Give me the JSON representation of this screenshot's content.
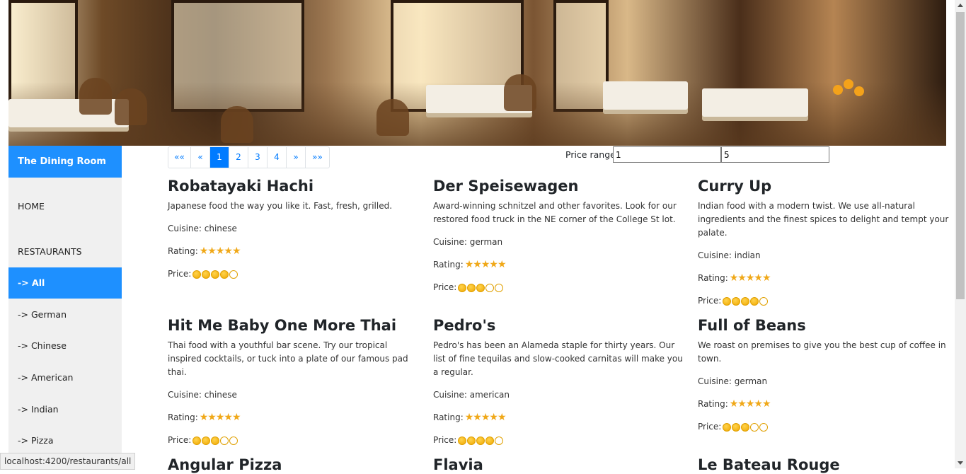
{
  "brand": "The Dining Room",
  "nav": {
    "home": "HOME",
    "restaurants": "RESTAURANTS",
    "items": [
      "-> All",
      "-> German",
      "-> Chinese",
      "-> American",
      "-> Indian",
      "-> Pizza"
    ]
  },
  "pagination": [
    "««",
    "«",
    "1",
    "2",
    "3",
    "4",
    "»",
    "»»"
  ],
  "price_range": {
    "label": "Price range",
    "min": "1",
    "max": "5"
  },
  "labels": {
    "cuisine": "Cuisine:",
    "rating": "Rating:",
    "price": "Price:"
  },
  "restaurants": [
    {
      "name": "Robatayaki Hachi",
      "description": "Japanese food the way you like it. Fast, fresh, grilled.",
      "cuisine": "chinese",
      "rating": 5,
      "price": 4
    },
    {
      "name": "Der Speisewagen",
      "description": "Award-winning schnitzel and other favorites. Look for our restored food truck in the NE corner of the College St lot.",
      "cuisine": "german",
      "rating": 5,
      "price": 3
    },
    {
      "name": "Curry Up",
      "description": "Indian food with a modern twist. We use all-natural ingredients and the finest spices to delight and tempt your palate.",
      "cuisine": "indian",
      "rating": 5,
      "price": 4
    },
    {
      "name": "Hit Me Baby One More Thai",
      "description": "Thai food with a youthful bar scene. Try our tropical inspired cocktails, or tuck into a plate of our famous pad thai.",
      "cuisine": "chinese",
      "rating": 5,
      "price": 3
    },
    {
      "name": "Pedro's",
      "description": "Pedro's has been an Alameda staple for thirty years. Our list of fine tequilas and slow-cooked carnitas will make you a regular.",
      "cuisine": "american",
      "rating": 5,
      "price": 4
    },
    {
      "name": "Full of Beans",
      "description": "We roast on premises to give you the best cup of coffee in town.",
      "cuisine": "german",
      "rating": 5,
      "price": 3
    },
    {
      "name": "Angular Pizza"
    },
    {
      "name": "Flavia"
    },
    {
      "name": "Le Bateau Rouge"
    }
  ],
  "status_url": "localhost:4200/restaurants/all",
  "colors": {
    "accent": "#1e90ff",
    "link": "#007bff",
    "star": "#f0a818"
  },
  "icons": {
    "rating": "star-icon",
    "price": "coin-icon"
  }
}
